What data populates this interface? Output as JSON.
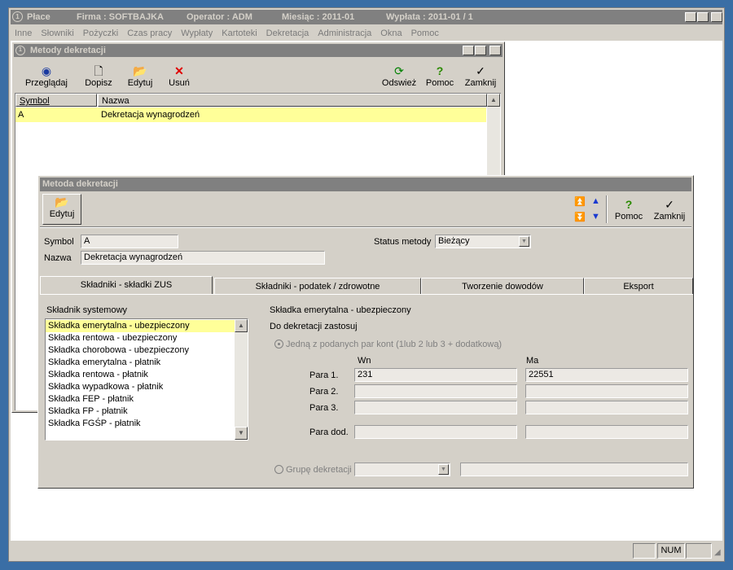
{
  "app": {
    "title": "Płace",
    "company": "Firma : SOFTBAJKA",
    "operator": "Operator : ADM",
    "month": "Miesiąc : 2011-01",
    "payout": "Wypłata : 2011-01 /  1"
  },
  "menu": [
    "Inne",
    "Słowniki",
    "Pożyczki",
    "Czas pracy",
    "Wypłaty",
    "Kartoteki",
    "Dekretacja",
    "Administracja",
    "Okna",
    "Pomoc"
  ],
  "list_window": {
    "title": "Metody dekretacji",
    "toolbar": {
      "browse": "Przeglądaj",
      "add": "Dopisz",
      "edit": "Edytuj",
      "delete": "Usuń",
      "refresh": "Odswież",
      "help": "Pomoc",
      "close": "Zamknij"
    },
    "columns": [
      "Symbol",
      "Nazwa"
    ],
    "rows": [
      {
        "symbol": "A",
        "name": "Dekretacja wynagrodzeń"
      }
    ]
  },
  "detail_window": {
    "title": "Metoda dekretacji",
    "toolbar": {
      "edit": "Edytuj",
      "help": "Pomoc",
      "close": "Zamknij"
    },
    "symbol_label": "Symbol",
    "symbol_value": "A",
    "name_label": "Nazwa",
    "name_value": "Dekretacja wynagrodzeń",
    "status_label": "Status metody",
    "status_value": "Bieżący",
    "tabs": [
      "Składniki - składki ZUS",
      "Składniki - podatek / zdrowotne",
      "Tworzenie dowodów",
      "Eksport"
    ],
    "system_component_label": "Składnik systemowy",
    "components": [
      "Składka emerytalna - ubezpieczony",
      "Składka rentowa - ubezpieczony",
      "Składka chorobowa - ubezpieczony",
      "Składka emerytalna - płatnik",
      "Składka rentowa - płatnik",
      "Składka wypadkowa - płatnik",
      "Składka FEP - płatnik",
      "Składka FP - płatnik",
      "Składka FGŚP - płatnik"
    ],
    "selected_component": "Składka emerytalna - ubezpieczony",
    "apply_label": "Do dekretacji zastosuj",
    "radio_pairs_label": "Jedną z podanych par kont (1lub 2 lub 3 + dodatkową)",
    "wn_label": "Wn",
    "ma_label": "Ma",
    "pairs": [
      {
        "label": "Para 1.",
        "wn": "231",
        "ma": "22551"
      },
      {
        "label": "Para 2.",
        "wn": "",
        "ma": ""
      },
      {
        "label": "Para 3.",
        "wn": "",
        "ma": ""
      },
      {
        "label": "Para dod.",
        "wn": "",
        "ma": ""
      }
    ],
    "radio_group_label": "Grupę dekretacji"
  },
  "status_bar": {
    "num": "NUM"
  },
  "colors": {
    "desktop": "#3a6ea5",
    "face": "#d4d0c8",
    "selection": "#ffff99",
    "inactive_title": "#808080"
  }
}
